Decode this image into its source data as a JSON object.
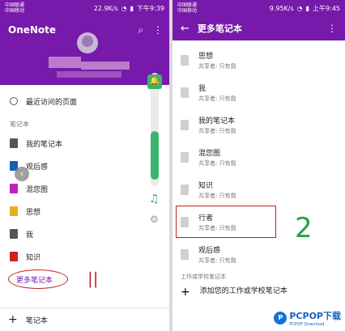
{
  "left": {
    "status": {
      "carrier1": "中国联通",
      "carrier2": "中国移动",
      "speed": "22.9K/s",
      "time": "下午9:39"
    },
    "app_title": "OneNote",
    "recent": "最近访问的页面",
    "section": "笔记本",
    "notebooks": [
      {
        "name": "我的笔记本",
        "color": "#555555"
      },
      {
        "name": "观后感",
        "color": "#1a5fb4"
      },
      {
        "name": "混您图",
        "color": "#c020c0"
      },
      {
        "name": "思想",
        "color": "#e0b020"
      },
      {
        "name": "我",
        "color": "#555555"
      },
      {
        "name": "知识",
        "color": "#d02020"
      }
    ],
    "more": "更多笔记本",
    "annotation": "||",
    "footer": "笔记本"
  },
  "right": {
    "status": {
      "carrier1": "中国联通",
      "carrier2": "中国移动",
      "speed": "9.95K/s",
      "time": "上午9:45"
    },
    "title": "更多笔记本",
    "notebooks": [
      {
        "name": "思想",
        "share": "共享者: 只有我"
      },
      {
        "name": "我",
        "share": "共享者: 只有我"
      },
      {
        "name": "我的笔记本",
        "share": "共享者: 只有我"
      },
      {
        "name": "混您图",
        "share": "共享者: 只有我"
      },
      {
        "name": "知识",
        "share": "共享者: 只有我"
      },
      {
        "name": "行者",
        "share": "共享者: 只有我"
      },
      {
        "name": "观后感",
        "share": "共享者: 只有我"
      }
    ],
    "section": "工作或学校笔记本",
    "add_text": "添加您的工作或学校笔记本",
    "annotation": "2"
  },
  "watermark": {
    "brand": "PCPOP下载",
    "sub": "PCPOP Download",
    "logo": "P"
  },
  "colors": {
    "accent": "#7719aa",
    "highlight": "#c02020",
    "green": "#3cb36b"
  }
}
